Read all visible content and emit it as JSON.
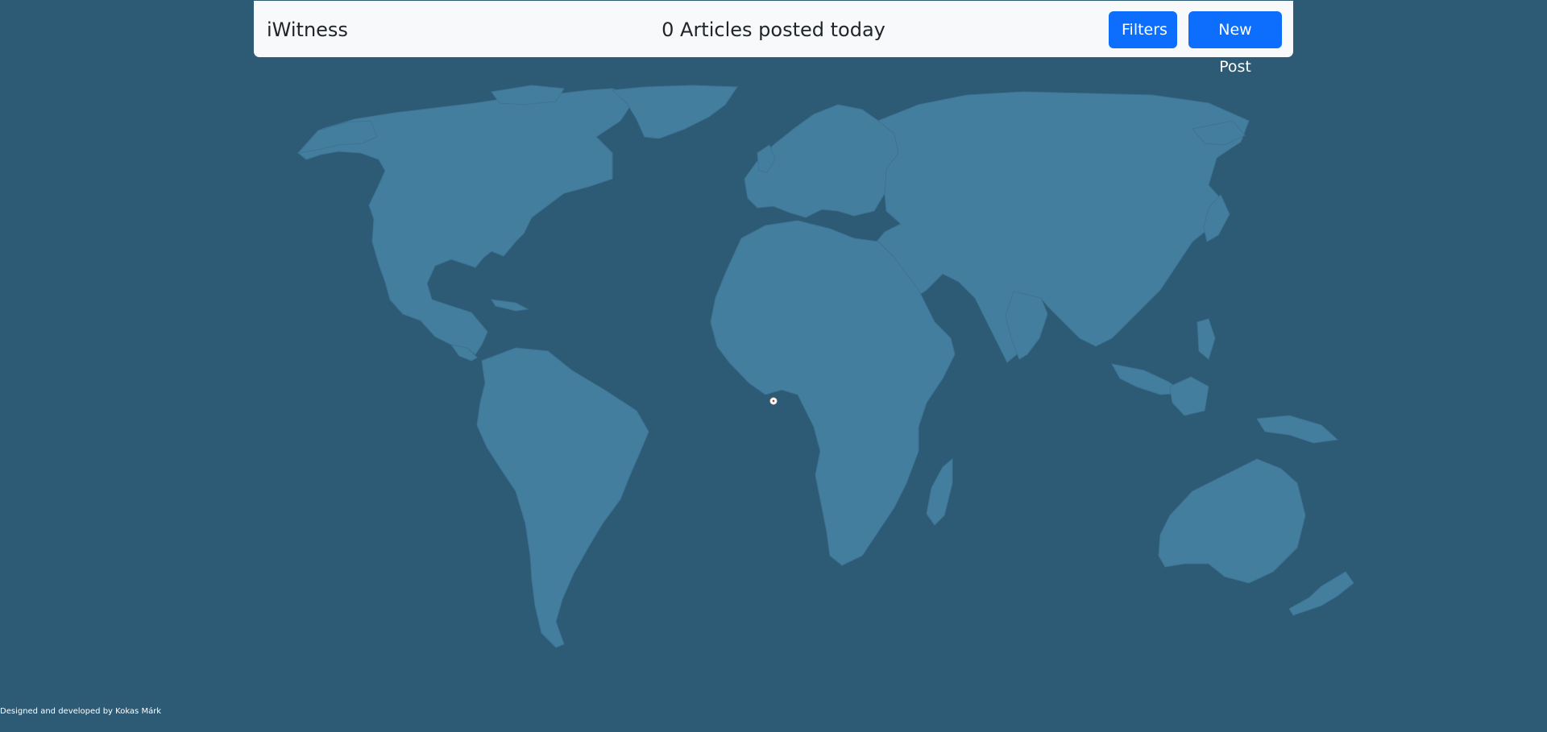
{
  "app": {
    "brand": "iWitness"
  },
  "header": {
    "article_count_text": "0 Articles posted today",
    "filters_label": "Filters",
    "new_post_label": "New Post"
  },
  "colors": {
    "ocean": "#2d5a74",
    "land": "#447e9f",
    "navbar_bg": "#f8f9fa",
    "button_primary": "#0d6efd",
    "marker": "#ffffff"
  },
  "map": {
    "marker_icon": "location-marker-icon"
  },
  "footer": {
    "credit": "Designed and developed by Kokas Márk"
  }
}
